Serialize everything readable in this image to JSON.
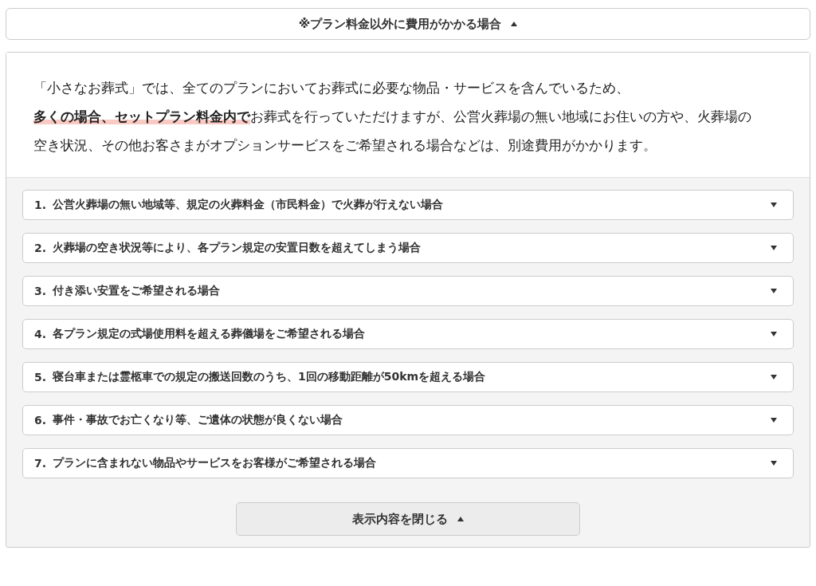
{
  "header": {
    "label": "※プラン料金以外に費用がかかる場合",
    "expanded": true
  },
  "intro": [
    "「小さなお葬式」では、全てのプランにおいてお葬式に必要な物品・サービスを含んでいるため、",
    "**多くの場合、セットプラン料金内で**お葬式を行っていただけますが、公営火葬場の無い地域にお住いの方や、火葬場の空き状況、その他お客さまがオプションサービスをご希望される場合などは、別途費用がかかります。"
  ],
  "items": [
    {
      "number": "1.",
      "label": "公営火葬場の無い地域等、規定の火葬料金（市民料金）で火葬が行えない場合",
      "expanded": false
    },
    {
      "number": "2.",
      "label": "火葬場の空き状況等により、各プラン規定の安置日数を超えてしまう場合",
      "expanded": false
    },
    {
      "number": "3.",
      "label": "付き添い安置をご希望される場合",
      "expanded": false
    },
    {
      "number": "4.",
      "label": "各プラン規定の式場使用料を超える葬儀場をご希望される場合",
      "expanded": false
    },
    {
      "number": "5.",
      "label": "寝台車または霊柩車での規定の搬送回数のうち、1回の移動距離が50kmを超える場合",
      "expanded": false
    },
    {
      "number": "6.",
      "label": "事件・事故でお亡くなり等、ご遺体の状態が良くない場合",
      "expanded": false
    },
    {
      "number": "7.",
      "label": "プランに含まれない物品やサービスをお客様がご希望される場合",
      "expanded": false
    }
  ],
  "close_button": {
    "label": "表示内容を閉じる"
  }
}
